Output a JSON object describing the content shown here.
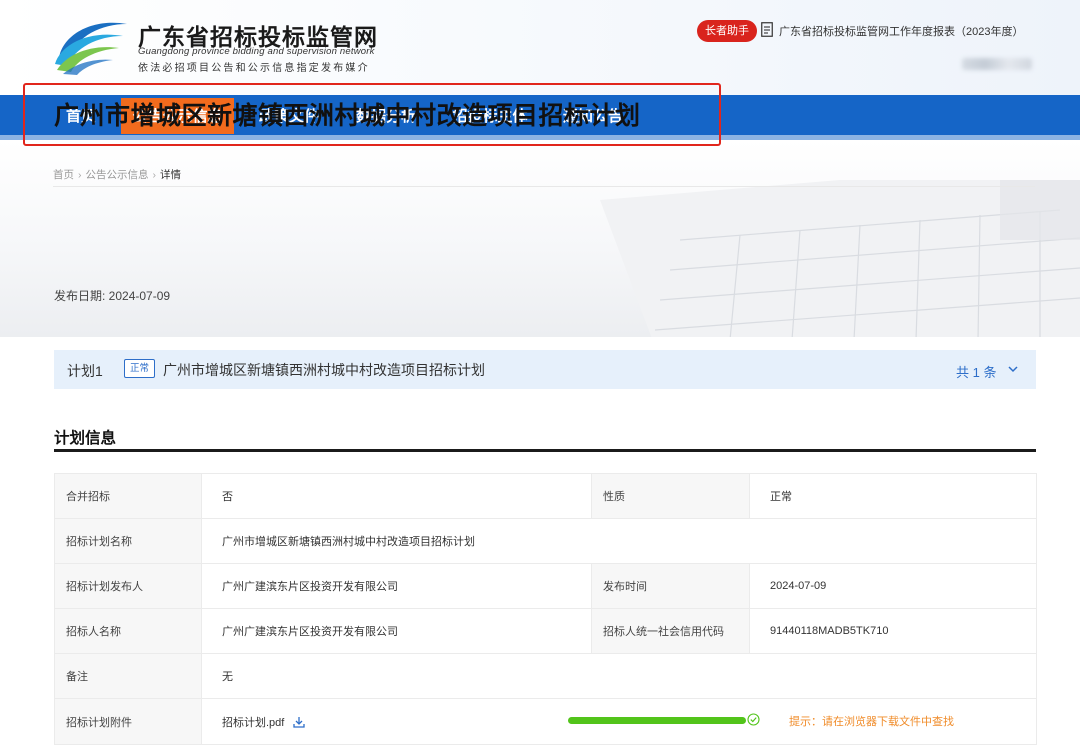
{
  "header": {
    "site_title": "广东省招标投标监管网",
    "site_subtitle": "Guangdong province bidding and supervision network",
    "site_slogan": "依法必招项目公告和公示信息指定发布媒介",
    "elder_button": "长者助手",
    "report_link": "广东省招标投标监管网工作年度报表（2023年度）"
  },
  "nav": {
    "items": [
      {
        "label": "首页"
      },
      {
        "label": "公告公示信息"
      },
      {
        "label": "政策文件"
      },
      {
        "label": "数据分析"
      },
      {
        "label": "招投标主体"
      },
      {
        "label": "通知公告"
      }
    ],
    "active_index": 1,
    "color": "#1565c7",
    "active_color": "#f26b1d"
  },
  "breadcrumb": {
    "items": [
      "首页",
      "公告公示信息",
      "详情"
    ],
    "separator": "›"
  },
  "page": {
    "title": "广州市增城区新塘镇西洲村城中村改造项目招标计划",
    "publish_date": "发布日期: 2024-07-09",
    "highlight_color": "#e1261c"
  },
  "plan_bar": {
    "plan_no": "计划1",
    "tag": "正常",
    "name": "广州市增城区新塘镇西洲村城中村改造项目招标计划",
    "count": "共 1 条"
  },
  "section": {
    "title": "计划信息"
  },
  "table": {
    "rows": [
      {
        "k1": "合并招标",
        "v1": "否",
        "k2": "性质",
        "v2": "正常"
      },
      {
        "k1": "招标计划名称",
        "v1": "广州市增城区新塘镇西洲村城中村改造项目招标计划"
      },
      {
        "k1": "招标计划发布人",
        "v1": "广州广建滨东片区投资开发有限公司",
        "k2": "发布时间",
        "v2": "2024-07-09"
      },
      {
        "k1": "招标人名称",
        "v1": "广州广建滨东片区投资开发有限公司",
        "k2": "招标人统一社会信用代码",
        "v2": "91440118MADB5TK710"
      },
      {
        "k1": "备注",
        "v1": "无"
      },
      {
        "k1": "招标计划附件",
        "v1": "招标计划.pdf"
      }
    ],
    "attachment_progress": 1.0,
    "hint": "提示：请在浏览器下载文件中查找",
    "hint_color": "#f08c2a"
  }
}
